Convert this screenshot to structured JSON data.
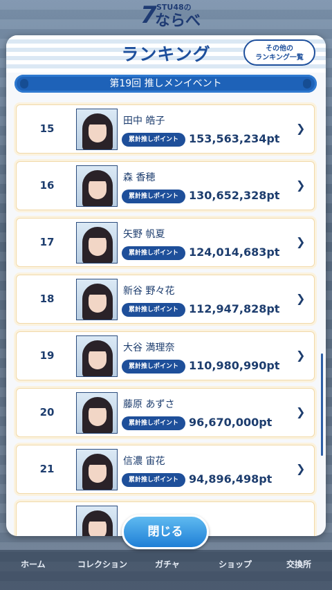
{
  "logo": {
    "number": "7",
    "group": "STU48の",
    "title": "ならべ"
  },
  "modal": {
    "title": "ランキング",
    "other_button": [
      "その他の",
      "ランキング一覧"
    ],
    "event_title": "第19回 推しメンイベント",
    "badge_label": "累計推しポイント",
    "rows": [
      {
        "rank": "15",
        "name": "田中 皓子",
        "points": "153,563,234pt"
      },
      {
        "rank": "16",
        "name": "森 香穂",
        "points": "130,652,328pt"
      },
      {
        "rank": "17",
        "name": "矢野 帆夏",
        "points": "124,014,683pt"
      },
      {
        "rank": "18",
        "name": "新谷 野々花",
        "points": "112,947,828pt"
      },
      {
        "rank": "19",
        "name": "大谷 満理奈",
        "points": "110,980,990pt"
      },
      {
        "rank": "20",
        "name": "藤原 あずさ",
        "points": "96,670,000pt"
      },
      {
        "rank": "21",
        "name": "信濃 宙花",
        "points": "94,896,498pt"
      }
    ],
    "close_label": "閉じる"
  },
  "bottom_nav": [
    "ホーム",
    "コレクション",
    "ガチャ",
    "ショップ",
    "交換所"
  ],
  "icons": {
    "row_arrow": "chevron-right-icon",
    "photo": "member-photo"
  },
  "colors": {
    "accent": "#1d4f9c",
    "badge": "#1e4f9a",
    "close_button": "#2a8ce0",
    "row_border": "#f1d9a8"
  }
}
